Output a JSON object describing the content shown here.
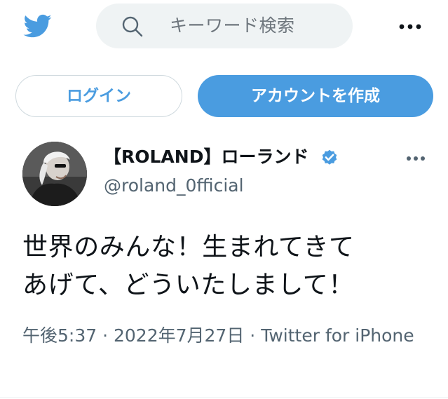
{
  "header": {
    "logo_icon": "twitter-bird-icon",
    "search_placeholder": "キーワード検索",
    "more_icon": "more-horizontal-icon"
  },
  "auth": {
    "login_label": "ログイン",
    "signup_label": "アカウントを作成"
  },
  "tweet": {
    "display_name": "【ROLAND】ローランド",
    "verified_icon": "verified-badge-icon",
    "handle": "@roland_0fficial",
    "text_line1": "世界のみんな！生まれてきて",
    "text_line2": "あげて、どういたしまして！",
    "time": "午後5:37",
    "separator": "·",
    "date": "2022年7月27日",
    "source": "Twitter for iPhone"
  },
  "colors": {
    "accent": "#4a9ce0",
    "secondary_text": "#536471",
    "search_bg": "#eff3f4"
  }
}
